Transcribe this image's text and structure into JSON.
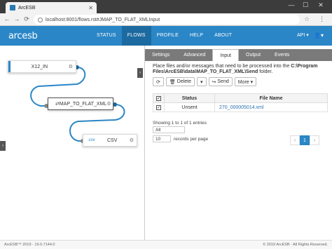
{
  "browser": {
    "tab_title": "ArcESB",
    "url": "localhost:8001/flows.rst#JMAP_TO_FLAT_XMLInput",
    "win_min": "—",
    "win_max": "☐",
    "win_close": "✕",
    "tab_close": "✕"
  },
  "app": {
    "logo": "arcesb",
    "menu": [
      {
        "label": "STATUS"
      },
      {
        "label": "FLOWS"
      },
      {
        "label": "PROFILE"
      },
      {
        "label": "HELP"
      },
      {
        "label": "ABOUT"
      }
    ],
    "api_menu": "API ▾",
    "user_menu": "👤▾"
  },
  "canvas": {
    "nodes": [
      {
        "label": "X12_IN",
        "ext": ""
      },
      {
        "label": "MAP_TO_FLAT_XML",
        "ext": ""
      },
      {
        "label": "CSV",
        "ext": ".csv"
      }
    ]
  },
  "panel": {
    "tabs": [
      {
        "label": "Settings"
      },
      {
        "label": "Advanced"
      },
      {
        "label": "Input"
      },
      {
        "label": "Output"
      },
      {
        "label": "Events"
      }
    ],
    "desc_prefix": "Place files and/or messages that need to be processed into the ",
    "desc_path": "C:\\Program Files\\ArcESB\\data\\MAP_TO_FLAT_XML\\Send",
    "desc_suffix": " folder.",
    "toolbar": {
      "refresh": "⟳",
      "delete": "Delete",
      "dropdown": "▾",
      "send": "Send",
      "more": "More ▾"
    },
    "table": {
      "headers": [
        "",
        "Status",
        "File Name"
      ],
      "rows": [
        {
          "checked": "✓",
          "status": "Unsent",
          "file": "270_000005014.xml"
        }
      ]
    },
    "showing": "Showing 1 to 1 of 1 entries",
    "filter_value": "All",
    "per_page_value": "10",
    "per_page_label": "records per page",
    "pager": {
      "prev": "‹",
      "page": "1",
      "next": "›"
    }
  },
  "footer": {
    "left": "ArcESB™ 2019 - 19.0.7144.0",
    "right": "© 2019 ArcESB - All Rights Reserved."
  }
}
